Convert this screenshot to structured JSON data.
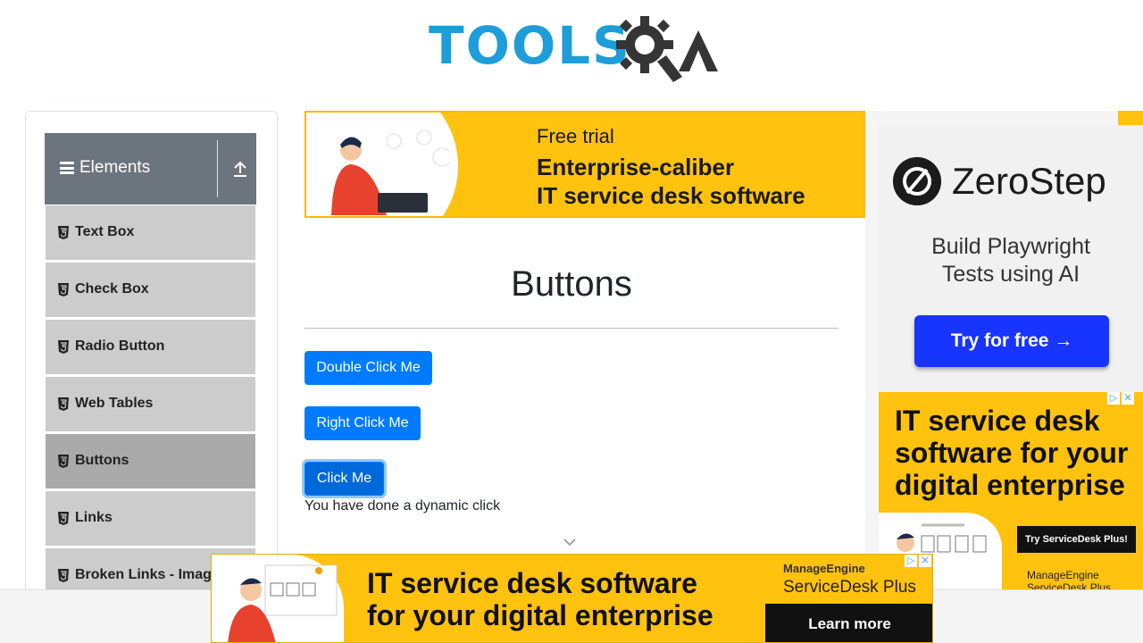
{
  "header": {
    "logo_text_1": "TOOLS",
    "logo_text_2": "QA"
  },
  "sidebar": {
    "group_title": "Elements",
    "items": [
      {
        "label": "Text Box"
      },
      {
        "label": "Check Box"
      },
      {
        "label": "Radio Button"
      },
      {
        "label": "Web Tables"
      },
      {
        "label": "Buttons",
        "active": true
      },
      {
        "label": "Links"
      },
      {
        "label": "Broken Links - Images"
      }
    ]
  },
  "top_ad": {
    "line1": "Free trial",
    "line2": "Enterprise-caliber",
    "line3": "IT service desk software"
  },
  "main": {
    "title": "Buttons",
    "double_click_label": "Double Click Me",
    "right_click_label": "Right Click Me",
    "click_label": "Click Me",
    "message": "You have done a dynamic click"
  },
  "right_ad_1": {
    "brand": "ZeroStep",
    "tagline_1": "Build Playwright",
    "tagline_2": "Tests using AI",
    "cta": "Try for free →"
  },
  "right_ad_2": {
    "headline": "IT service desk software for your digital enterprise",
    "cta": "Try ServiceDesk Plus!",
    "brand_1": "ManageEngine",
    "brand_2": "ServiceDesk Plus"
  },
  "bottom_ad": {
    "line1": "IT service desk software",
    "line2": "for your digital enterprise",
    "brand_1": "ManageEngine",
    "brand_2": "ServiceDesk Plus",
    "cta": "Learn more"
  },
  "icons": {
    "menu": "hamburger-icon",
    "collapse": "upload-arrow-icon",
    "item": "html5-icon",
    "scroll": "chevron-down-icon",
    "ad_choices": "ad-choices-icon",
    "ad_close": "close-icon"
  },
  "colors": {
    "primary": "#007bff",
    "group_header": "#6c757d",
    "menu_item": "#cccccc",
    "menu_active": "#aaaaaa",
    "ad_yellow": "#ffc20f",
    "logo_blue": "#1d9dd9"
  }
}
